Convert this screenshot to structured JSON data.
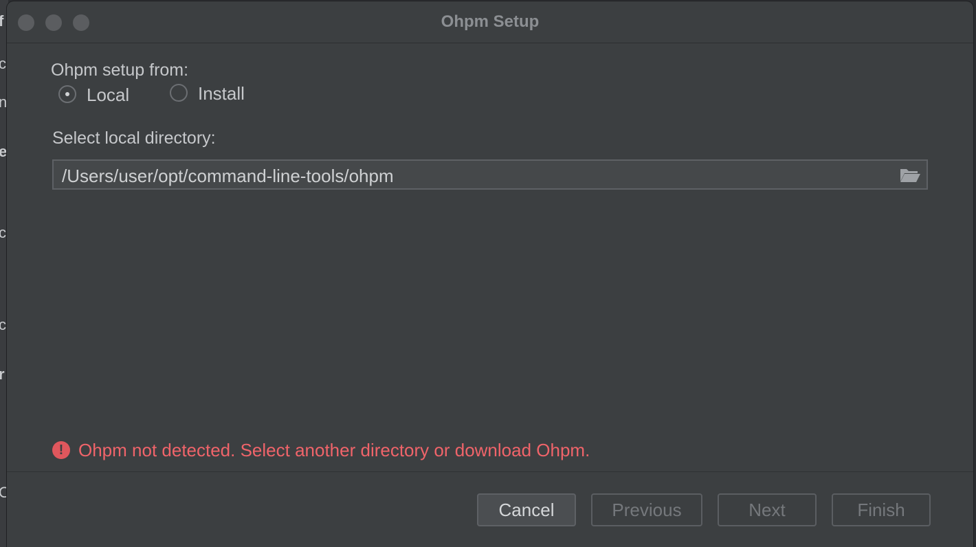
{
  "window": {
    "title": "Ohpm Setup"
  },
  "setup_from": {
    "label": "Ohpm setup from:",
    "options": [
      {
        "label": "Local",
        "selected": true
      },
      {
        "label": "Install",
        "selected": false
      }
    ]
  },
  "directory": {
    "label": "Select local directory:",
    "value": "/Users/user/opt/command-line-tools/ohpm",
    "browse_icon": "folder-open-icon"
  },
  "error": {
    "icon": "error-icon",
    "glyph": "!",
    "message": "Ohpm not detected. Select another directory or download Ohpm.",
    "color": "#f0646a"
  },
  "buttons": {
    "cancel": "Cancel",
    "previous": "Previous",
    "next": "Next",
    "finish": "Finish"
  },
  "background_fragments": [
    "f",
    "c",
    "n",
    "e",
    "c",
    "c",
    "r",
    "O"
  ]
}
